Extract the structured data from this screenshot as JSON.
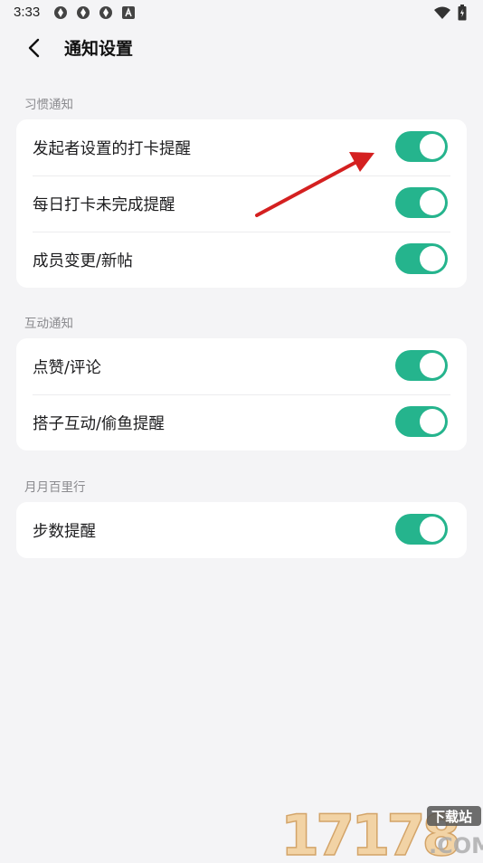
{
  "status_bar": {
    "time": "3:33",
    "left_icons": [
      "sync-icon",
      "sync-icon",
      "sync-icon",
      "font-a-icon"
    ],
    "right_icons": [
      "wifi-icon",
      "battery-icon"
    ]
  },
  "header": {
    "title": "通知设置",
    "back_icon": "chevron-left-icon"
  },
  "sections": [
    {
      "label": "习惯通知",
      "items": [
        {
          "label": "发起者设置的打卡提醒",
          "enabled": true
        },
        {
          "label": "每日打卡未完成提醒",
          "enabled": true
        },
        {
          "label": "成员变更/新帖",
          "enabled": true
        }
      ]
    },
    {
      "label": "互动通知",
      "items": [
        {
          "label": "点赞/评论",
          "enabled": true
        },
        {
          "label": "搭子互动/偷鱼提醒",
          "enabled": true
        }
      ]
    },
    {
      "label": "月月百里行",
      "items": [
        {
          "label": "步数提醒",
          "enabled": true
        }
      ]
    }
  ],
  "colors": {
    "toggle_on": "#25b48d",
    "background": "#f4f4f6",
    "annotation_arrow": "#d42020"
  },
  "watermark": {
    "number": "17178",
    "badge": "下载站",
    "domain": ".COM"
  }
}
